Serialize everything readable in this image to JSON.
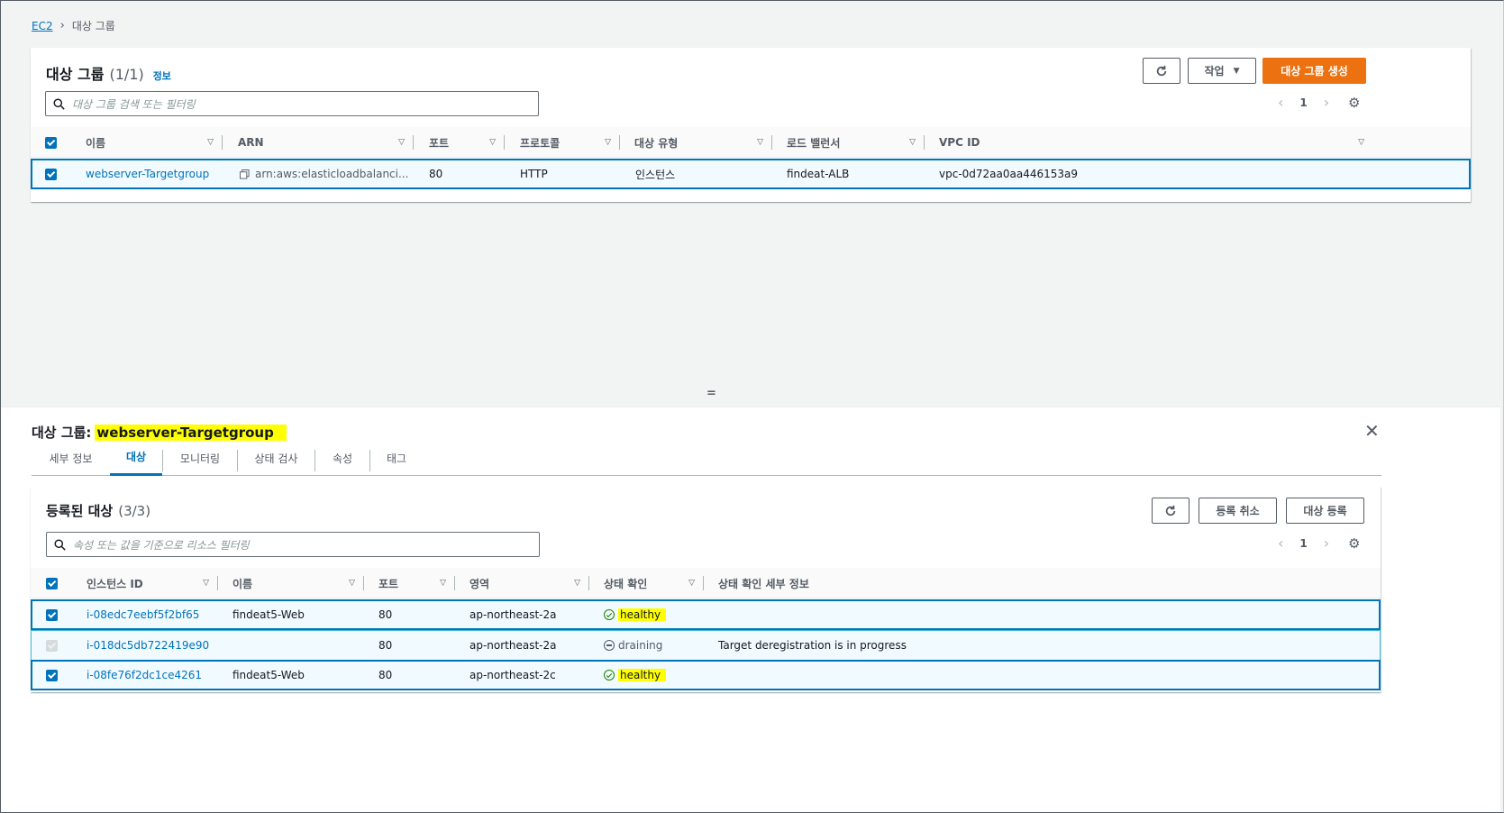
{
  "breadcrumb": {
    "root": "EC2",
    "current": "대상 그룹"
  },
  "target_groups": {
    "title": "대상 그룹",
    "count": "(1/1)",
    "info": "정보",
    "actions_label": "작업",
    "create_label": "대상 그룹 생성",
    "search_placeholder": "대상 그룹 검색 또는 필터링",
    "page": "1",
    "columns": [
      "이름",
      "ARN",
      "포트",
      "프로토콜",
      "대상 유형",
      "로드 밸런서",
      "VPC ID"
    ],
    "rows": [
      {
        "name": "webserver-Targetgroup",
        "arn": "arn:aws:elasticloadbalanci...",
        "port": "80",
        "protocol": "HTTP",
        "target_type": "인스턴스",
        "load_balancer": "findeat-ALB",
        "vpc_id": "vpc-0d72aa0aa446153a9"
      }
    ]
  },
  "split_panel": {
    "title_prefix": "대상 그룹:",
    "title_name": "webserver-Targetgroup",
    "tabs": [
      "세부 정보",
      "대상",
      "모니터링",
      "상태 검사",
      "속성",
      "태그"
    ],
    "active_tab": "대상"
  },
  "registered_targets": {
    "title": "등록된 대상",
    "count": "(3/3)",
    "deregister_label": "등록 취소",
    "register_label": "대상 등록",
    "search_placeholder": "속성 또는 값을 기준으로 리소스 필터링",
    "page": "1",
    "columns": [
      "인스턴스 ID",
      "이름",
      "포트",
      "영역",
      "상태 확인",
      "상태 확인 세부 정보"
    ],
    "rows": [
      {
        "instance_id": "i-08edc7eebf5f2bf65",
        "name": "findeat5-Web",
        "port": "80",
        "zone": "ap-northeast-2a",
        "health": "healthy",
        "details": ""
      },
      {
        "instance_id": "i-018dc5db722419e90",
        "name": "",
        "port": "80",
        "zone": "ap-northeast-2a",
        "health": "draining",
        "details": "Target deregistration is in progress"
      },
      {
        "instance_id": "i-08fe76f2dc1ce4261",
        "name": "findeat5-Web",
        "port": "80",
        "zone": "ap-northeast-2c",
        "health": "healthy",
        "details": ""
      }
    ]
  },
  "colors": {
    "link": "#0073bb",
    "primary": "#ec7211",
    "highlight": "#ffff00",
    "healthy": "#1d8102"
  }
}
